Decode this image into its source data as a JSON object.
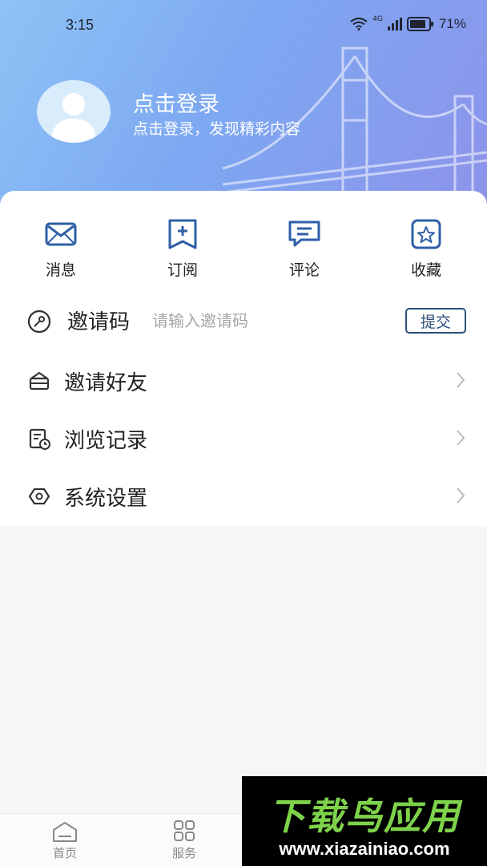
{
  "status_bar": {
    "time": "3:15",
    "network": "4G",
    "battery": "71%"
  },
  "header": {
    "title": "点击登录",
    "subtitle": "点击登录，发现精彩内容"
  },
  "quick_actions": [
    {
      "label": "消息",
      "icon": "mail-icon"
    },
    {
      "label": "订阅",
      "icon": "bookmark-plus-icon"
    },
    {
      "label": "评论",
      "icon": "comment-icon"
    },
    {
      "label": "收藏",
      "icon": "star-icon"
    }
  ],
  "invite": {
    "label": "邀请码",
    "placeholder": "请输入邀请码",
    "submit_label": "提交"
  },
  "menu": [
    {
      "label": "邀请好友",
      "icon": "invite-friend-icon"
    },
    {
      "label": "浏览记录",
      "icon": "history-icon"
    },
    {
      "label": "系统设置",
      "icon": "settings-icon"
    }
  ],
  "bottom_nav": [
    {
      "label": "首页",
      "icon": "home-icon"
    },
    {
      "label": "服务",
      "icon": "grid-icon"
    }
  ],
  "watermark": {
    "title": "下载鸟应用",
    "url": "www.xiazainiao.com"
  },
  "colors": {
    "accent": "#2f5fa8",
    "header_gradient_start": "#8ec3f5",
    "header_gradient_end": "#8d93ea"
  }
}
